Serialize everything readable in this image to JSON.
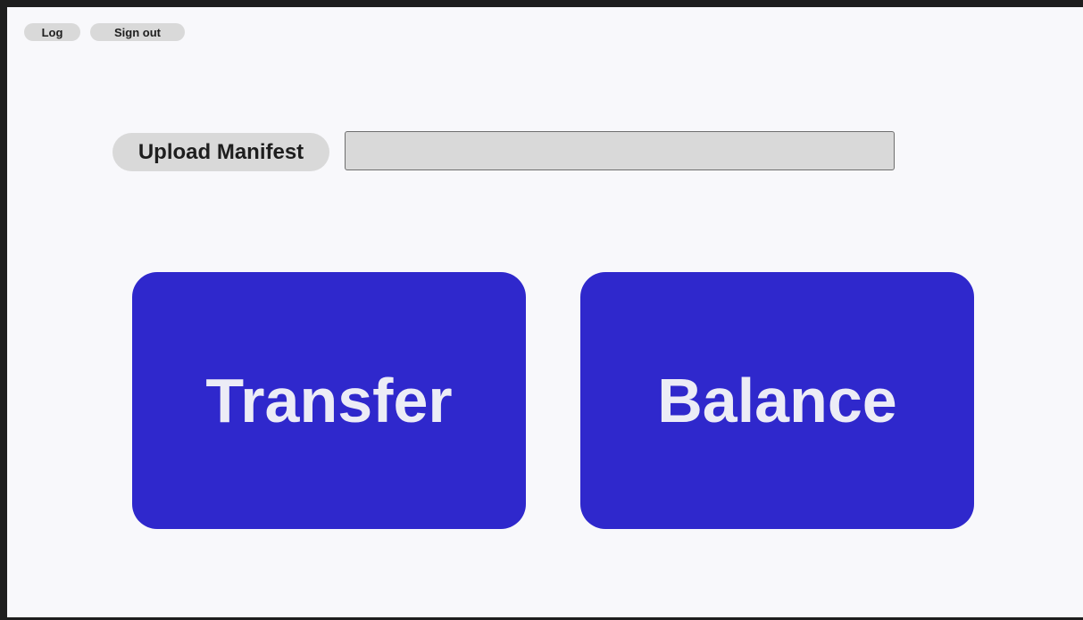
{
  "header": {
    "log_label": "Log",
    "signout_label": "Sign out"
  },
  "upload": {
    "button_label": "Upload Manifest",
    "field_value": ""
  },
  "actions": {
    "transfer_label": "Transfer",
    "balance_label": "Balance"
  },
  "colors": {
    "primary": "#2f28cc",
    "primary_text": "#ececf6",
    "pill_bg": "#d9d9d9",
    "page_bg": "#f8f8fb"
  }
}
